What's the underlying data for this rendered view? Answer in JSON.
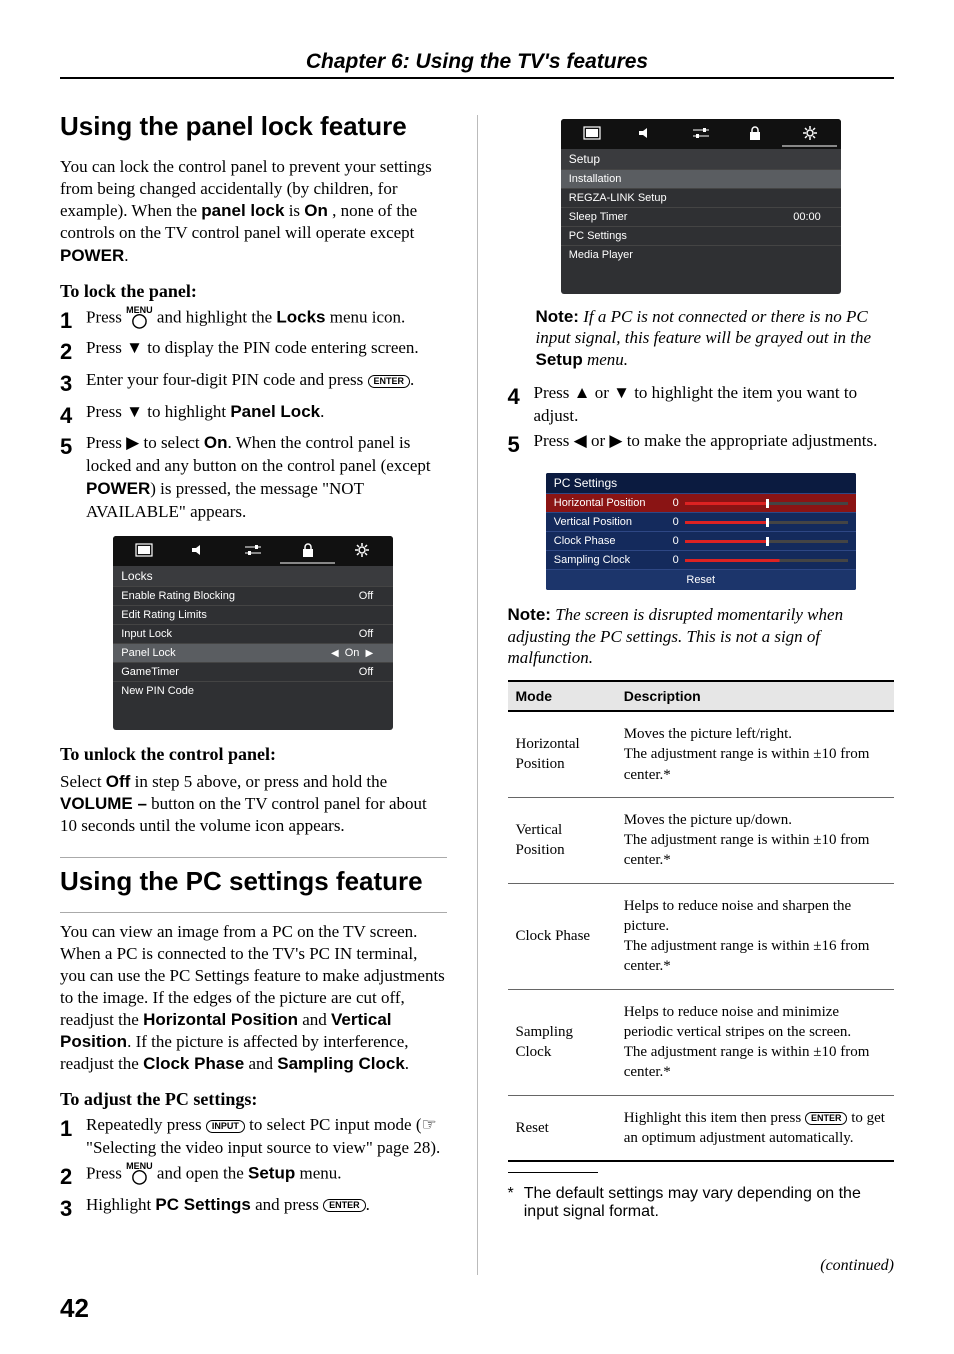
{
  "chapter": {
    "title": "Chapter 6: Using the TV's features"
  },
  "pageNumber": "42",
  "continued": "(continued)",
  "panelLock": {
    "heading": "Using the panel lock feature",
    "intro_pre": "You can lock the control panel to prevent your settings from being changed accidentally (by children, for example). When the ",
    "intro_b1": "panel lock",
    "intro_mid": " is ",
    "intro_b2": "On",
    "intro_post": ", none of the controls on the TV control panel will operate except ",
    "intro_b3": "POWER",
    "intro_end": ".",
    "lockHeading": "To lock the panel:",
    "steps": {
      "s1_pre": "Press ",
      "s1_post_a": " and highlight the ",
      "s1_b": "Locks",
      "s1_post_b": " menu icon.",
      "s2": "Press ▼ to display the PIN code entering screen.",
      "s3_pre": "Enter your four-digit PIN code and press ",
      "s3_post": ".",
      "s4_pre": "Press ▼ to highlight ",
      "s4_b": "Panel Lock",
      "s4_post": ".",
      "s5_pre": "Press ▶ to select ",
      "s5_b": "On",
      "s5_post_a": ". When the control panel is locked and any button on the control panel (except ",
      "s5_b2": "POWER",
      "s5_post_b": ") is pressed, the message \"NOT AVAILABLE\" appears."
    },
    "unlockHeading": "To unlock the control panel:",
    "unlock_pre": "Select ",
    "unlock_b1": "Off",
    "unlock_mid": " in step 5 above, or press and hold the ",
    "unlock_b2": "VOLUME –",
    "unlock_post": " button on the TV control panel for about 10 seconds until the volume icon appears."
  },
  "pcSettings": {
    "heading": "Using the PC settings feature",
    "intro_pre": "You can view an image from a PC on the TV screen. When a PC is connected to the TV's PC IN terminal, you can use the PC Settings feature to make adjustments to the image. If the edges of the picture are cut off, readjust the ",
    "intro_b1": "Horizontal Position",
    "intro_mid1": " and ",
    "intro_b2": "Vertical Position",
    "intro_mid2": ". If the picture is affected by interference, readjust the ",
    "intro_b3": "Clock Phase",
    "intro_mid3": " and ",
    "intro_b4": "Sampling Clock",
    "intro_end": ".",
    "adjustHeading": "To adjust the PC settings:",
    "steps": {
      "s1_pre": "Repeatedly press ",
      "s1_post": " to select PC input mode (☞ \"Selecting the video input source to view\" page 28).",
      "s2_pre": "Press ",
      "s2_mid": " and open the ",
      "s2_b": "Setup",
      "s2_post": " menu.",
      "s3_pre": "Highlight ",
      "s3_b": "PC Settings",
      "s3_mid": " and press ",
      "s3_post": "."
    },
    "note1_pre": "If a PC is not connected or there is no PC input signal, this feature will be grayed out in the ",
    "note1_b": "Setup",
    "note1_post": " menu.",
    "s4": "Press ▲ or ▼ to highlight the item you want to adjust.",
    "s5": "Press ◀ or ▶ to make the appropriate adjustments.",
    "note2": "The screen is disrupted momentarily when adjusting the PC settings. This is not a sign of malfunction.",
    "table": {
      "h_mode": "Mode",
      "h_desc": "Description",
      "r1_mode": "Horizontal Position",
      "r1_desc": "Moves the picture left/right.\nThe adjustment range is within ±10 from center.*",
      "r2_mode": "Vertical Position",
      "r2_desc": "Moves the picture up/down.\nThe adjustment range is within ±10 from center.*",
      "r3_mode": "Clock Phase",
      "r3_desc": "Helps to reduce noise and sharpen the picture.\nThe adjustment range is within ±16 from center.*",
      "r4_mode": "Sampling Clock",
      "r4_desc": "Helps to reduce noise and minimize periodic vertical stripes on the screen.\nThe adjustment range is within ±10 from center.*",
      "r5_mode": "Reset",
      "r5_desc_pre": "Highlight this item then press ",
      "r5_desc_post": " to get an optimum adjustment automatically."
    },
    "footnote": "The default settings may vary depending on the input signal format."
  },
  "osdLocks": {
    "title": "Locks",
    "items": [
      {
        "label": "Enable Rating Blocking",
        "val": "Off"
      },
      {
        "label": "Edit Rating Limits",
        "val": ""
      },
      {
        "label": "Input Lock",
        "val": "Off"
      },
      {
        "label": "Panel Lock",
        "val": "On",
        "hl": true,
        "arrows": true
      },
      {
        "label": "GameTimer",
        "val": "Off"
      },
      {
        "label": "New PIN Code",
        "val": ""
      }
    ]
  },
  "osdSetup": {
    "title": "Setup",
    "items": [
      {
        "label": "Installation",
        "val": "",
        "hl": true
      },
      {
        "label": "REGZA-LINK Setup",
        "val": ""
      },
      {
        "label": "Sleep Timer",
        "val": "00:00"
      },
      {
        "label": "PC Settings",
        "val": ""
      },
      {
        "label": "Media Player",
        "val": ""
      }
    ]
  },
  "osdPc": {
    "title": "PC Settings",
    "rows": [
      {
        "label": "Horizontal Position",
        "num": "0",
        "hl": true,
        "barClass": "center"
      },
      {
        "label": "Vertical Position",
        "num": "0",
        "barClass": "center"
      },
      {
        "label": "Clock Phase",
        "num": "0",
        "barClass": "center"
      },
      {
        "label": "Sampling Clock",
        "num": "0",
        "barClass": "q3"
      }
    ],
    "reset": "Reset"
  },
  "labels": {
    "menu": "MENU",
    "enter": "ENTER",
    "input": "INPUT",
    "note": "Note:"
  }
}
